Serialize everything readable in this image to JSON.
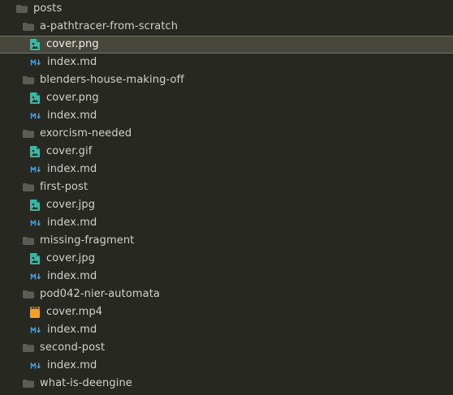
{
  "colors": {
    "background": "#272822",
    "text": "#d2d2cc",
    "selected_background": "#48473e",
    "folder": "#5c5c56",
    "image_icon": "#3fb5a6",
    "markdown_icon": "#4aa3df",
    "video_icon": "#f0a030"
  },
  "tree": [
    {
      "label": "posts",
      "icon": "folder-icon",
      "depth": 0
    },
    {
      "label": "a-pathtracer-from-scratch",
      "icon": "folder-icon",
      "depth": 1
    },
    {
      "label": "cover.png",
      "icon": "image-file-icon",
      "depth": 2,
      "selected": true
    },
    {
      "label": "index.md",
      "icon": "markdown-file-icon",
      "depth": 2
    },
    {
      "label": "blenders-house-making-off",
      "icon": "folder-icon",
      "depth": 1
    },
    {
      "label": "cover.png",
      "icon": "image-file-icon",
      "depth": 2
    },
    {
      "label": "index.md",
      "icon": "markdown-file-icon",
      "depth": 2
    },
    {
      "label": "exorcism-needed",
      "icon": "folder-icon",
      "depth": 1
    },
    {
      "label": "cover.gif",
      "icon": "image-file-icon",
      "depth": 2
    },
    {
      "label": "index.md",
      "icon": "markdown-file-icon",
      "depth": 2
    },
    {
      "label": "first-post",
      "icon": "folder-icon",
      "depth": 1
    },
    {
      "label": "cover.jpg",
      "icon": "image-file-icon",
      "depth": 2
    },
    {
      "label": "index.md",
      "icon": "markdown-file-icon",
      "depth": 2
    },
    {
      "label": "missing-fragment",
      "icon": "folder-icon",
      "depth": 1
    },
    {
      "label": "cover.jpg",
      "icon": "image-file-icon",
      "depth": 2
    },
    {
      "label": "index.md",
      "icon": "markdown-file-icon",
      "depth": 2
    },
    {
      "label": "pod042-nier-automata",
      "icon": "folder-icon",
      "depth": 1
    },
    {
      "label": "cover.mp4",
      "icon": "video-file-icon",
      "depth": 2
    },
    {
      "label": "index.md",
      "icon": "markdown-file-icon",
      "depth": 2
    },
    {
      "label": "second-post",
      "icon": "folder-icon",
      "depth": 1
    },
    {
      "label": "index.md",
      "icon": "markdown-file-icon",
      "depth": 2
    },
    {
      "label": "what-is-deengine",
      "icon": "folder-icon",
      "depth": 1
    }
  ]
}
